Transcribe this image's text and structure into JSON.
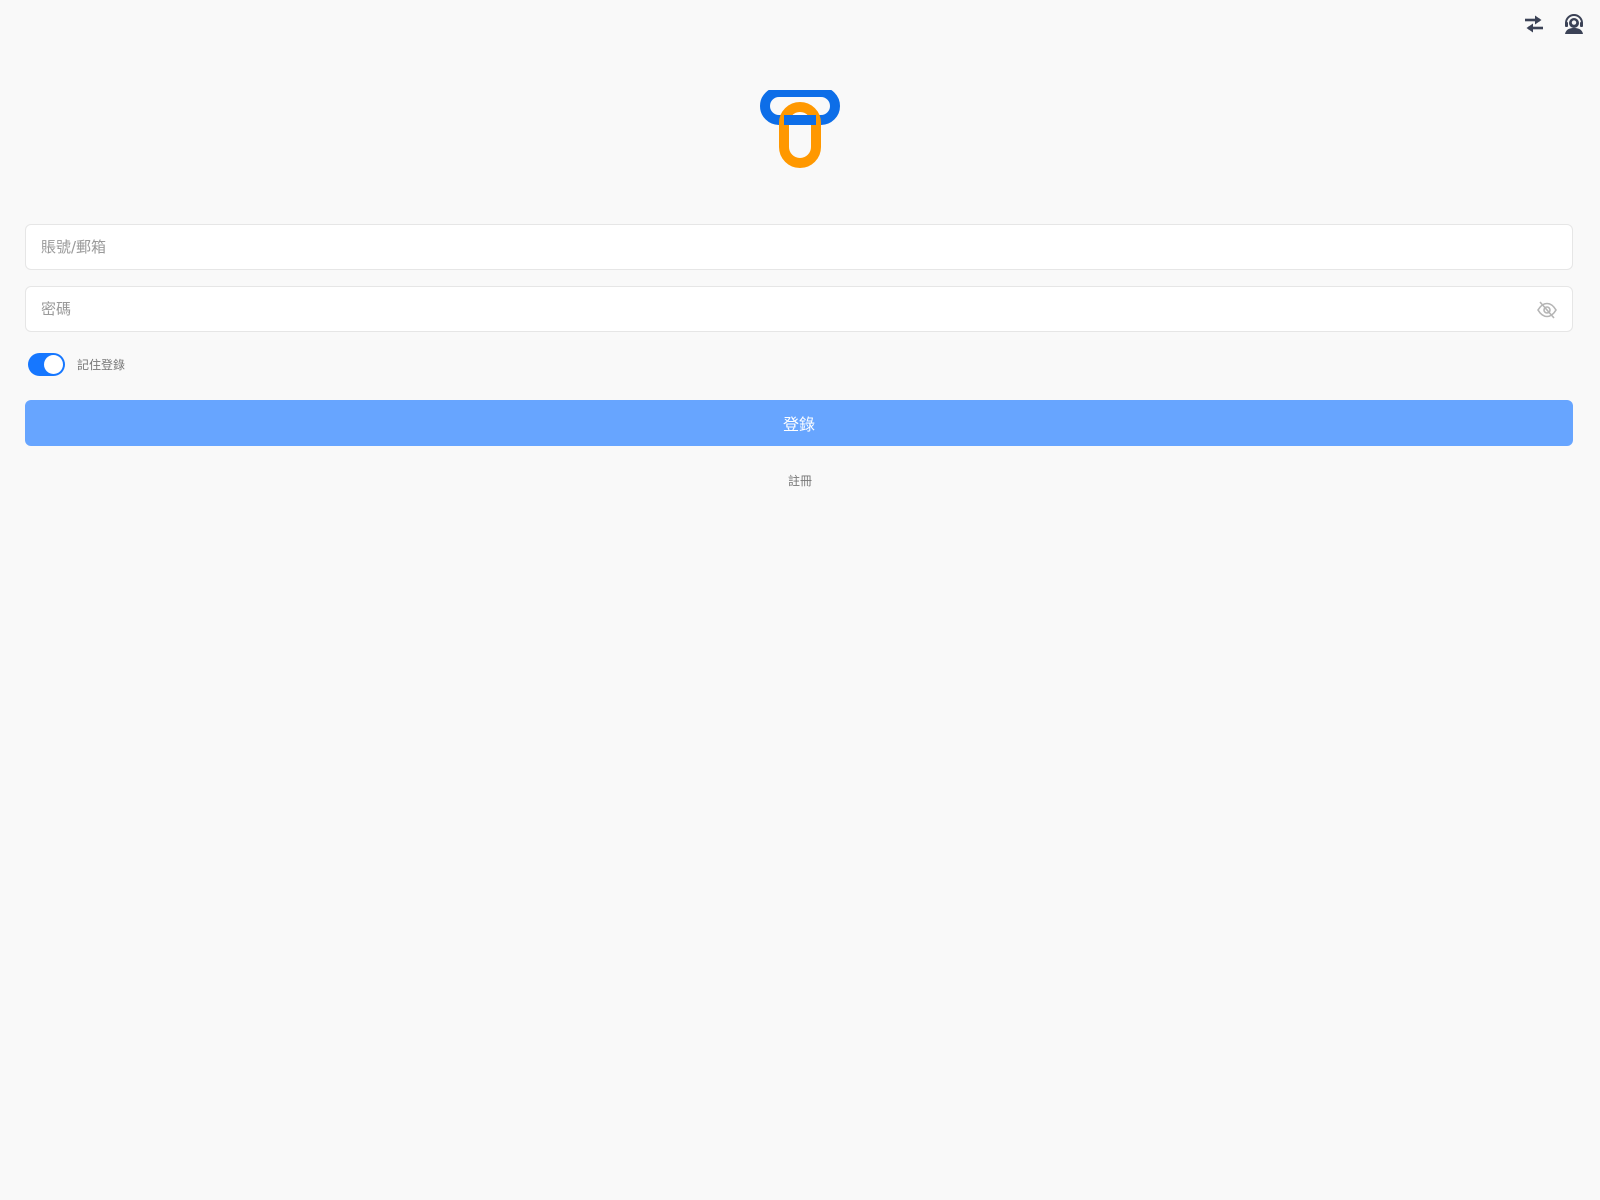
{
  "header": {
    "icons": [
      "swap-icon",
      "support-agent-icon"
    ]
  },
  "logo": {
    "primary_color": "#0d6ee8",
    "secondary_color": "#ff9800"
  },
  "form": {
    "account_placeholder": "賬號/郵箱",
    "password_placeholder": "密碼",
    "remember_label": "記住登錄",
    "remember_enabled": true,
    "login_label": "登錄",
    "register_label": "註冊"
  },
  "colors": {
    "accent": "#1677ff",
    "button": "#67a5ff",
    "background": "#f9f9f9"
  }
}
